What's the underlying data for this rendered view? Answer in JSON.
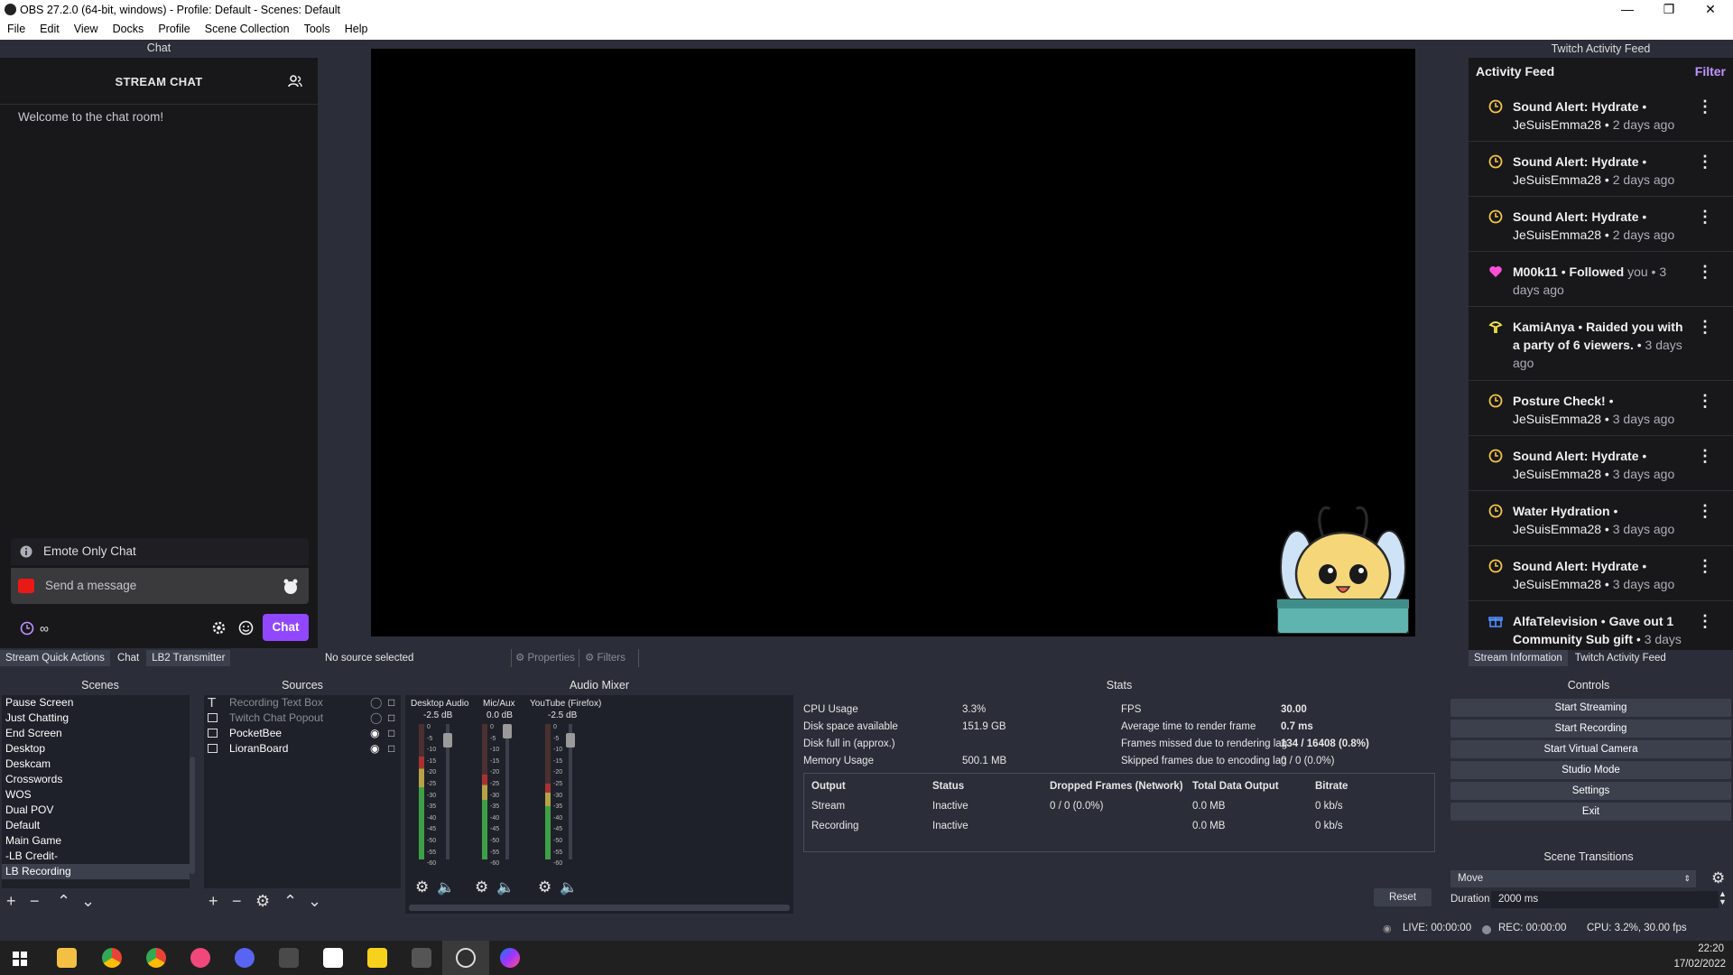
{
  "window": {
    "title": "OBS 27.2.0 (64-bit, windows) - Profile: Default - Scenes: Default"
  },
  "menu": [
    "File",
    "Edit",
    "View",
    "Docks",
    "Profile",
    "Scene Collection",
    "Tools",
    "Help"
  ],
  "chat_dock": {
    "dock_title": "Chat",
    "header": "STREAM CHAT",
    "welcome": "Welcome to the chat room!",
    "emote_only": "Emote Only Chat",
    "message_placeholder": "Send a message",
    "points": "∞",
    "send_button": "Chat"
  },
  "left_tabs": [
    "Stream Quick Actions",
    "Chat",
    "LB2 Transmitter"
  ],
  "source_toolbar": {
    "status": "No source selected",
    "properties": "Properties",
    "filters": "Filters"
  },
  "activity_feed": {
    "dock_title": "Twitch Activity Feed",
    "header": "Activity Feed",
    "filter": "Filter",
    "items": [
      {
        "title": "Sound Alert: Hydrate",
        "user": "JeSuisEmma28",
        "time": "2 days ago",
        "icon": "clock-icon"
      },
      {
        "title": "Sound Alert: Hydrate",
        "user": "JeSuisEmma28",
        "time": "2 days ago",
        "icon": "clock-icon"
      },
      {
        "title": "Sound Alert: Hydrate",
        "user": "JeSuisEmma28",
        "time": "2 days ago",
        "icon": "clock-icon"
      },
      {
        "title": "M00k11",
        "user": "Followed",
        "time": "you • 3 days ago",
        "icon": "heart-icon"
      },
      {
        "title": "KamiAnya",
        "user": "Raided you with a party of 6 viewers.",
        "time": "3 days ago",
        "icon": "raid-icon"
      },
      {
        "title": "Posture Check!",
        "user": "JeSuisEmma28",
        "time": "3 days ago",
        "icon": "clock-icon"
      },
      {
        "title": "Sound Alert: Hydrate",
        "user": "JeSuisEmma28",
        "time": "3 days ago",
        "icon": "clock-icon"
      },
      {
        "title": "Water Hydration",
        "user": "JeSuisEmma28",
        "time": "3 days ago",
        "icon": "clock-icon"
      },
      {
        "title": "Sound Alert: Hydrate",
        "user": "JeSuisEmma28",
        "time": "3 days ago",
        "icon": "clock-icon"
      },
      {
        "title": "AlfaTelevision",
        "user": "Gave out 1 Community Sub gift",
        "time": "3 days",
        "icon": "gift-icon"
      }
    ]
  },
  "right_tabs": [
    "Stream Information",
    "Twitch Activity Feed"
  ],
  "scenes": {
    "title": "Scenes",
    "items": [
      "Pause Screen",
      "Just Chatting",
      "End Screen",
      "Desktop",
      "Deskcam",
      "Crosswords",
      "WOS",
      "Dual POV",
      "Default",
      "Main Game",
      "-LB Credit-",
      "LB Recording"
    ],
    "selected": "LB Recording"
  },
  "sources": {
    "title": "Sources",
    "items": [
      {
        "name": "Recording Text Box",
        "visible": false
      },
      {
        "name": "Twitch Chat Popout",
        "visible": false
      },
      {
        "name": "PocketBee",
        "visible": true
      },
      {
        "name": "LioranBoard",
        "visible": true
      }
    ]
  },
  "audio_mixer": {
    "title": "Audio Mixer",
    "channels": [
      {
        "name": "Desktop Audio",
        "db": "-2.5 dB"
      },
      {
        "name": "Mic/Aux",
        "db": "0.0 dB"
      },
      {
        "name": "YouTube (Firefox)",
        "db": "-2.5 dB"
      }
    ],
    "scale": [
      "0",
      "-5",
      "-10",
      "-15",
      "-20",
      "-25",
      "-30",
      "-35",
      "-40",
      "-45",
      "-50",
      "-55",
      "-60"
    ]
  },
  "stats": {
    "title": "Stats",
    "left": [
      {
        "label": "CPU Usage",
        "value": "3.3%"
      },
      {
        "label": "Disk space available",
        "value": "151.9 GB"
      },
      {
        "label": "Disk full in (approx.)",
        "value": ""
      },
      {
        "label": "Memory Usage",
        "value": "500.1 MB"
      }
    ],
    "right": [
      {
        "label": "FPS",
        "value": "30.00"
      },
      {
        "label": "Average time to render frame",
        "value": "0.7 ms"
      },
      {
        "label": "Frames missed due to rendering lag",
        "value": "134 / 16408 (0.8%)"
      },
      {
        "label": "Skipped frames due to encoding lag",
        "value": "0 / 0 (0.0%)"
      }
    ],
    "table_headers": [
      "Output",
      "Status",
      "Dropped Frames (Network)",
      "Total Data Output",
      "Bitrate"
    ],
    "rows": [
      [
        "Stream",
        "Inactive",
        "0 / 0 (0.0%)",
        "0.0 MB",
        "0 kb/s"
      ],
      [
        "Recording",
        "Inactive",
        "",
        "0.0 MB",
        "0 kb/s"
      ]
    ],
    "reset": "Reset"
  },
  "controls": {
    "title": "Controls",
    "buttons": [
      "Start Streaming",
      "Start Recording",
      "Start Virtual Camera",
      "Studio Mode",
      "Settings",
      "Exit"
    ]
  },
  "transitions": {
    "title": "Scene Transitions",
    "selected": "Move",
    "duration_label": "Duration",
    "duration_value": "2000 ms"
  },
  "status_bar": {
    "live": "LIVE: 00:00:00",
    "rec": "REC: 00:00:00",
    "cpu": "CPU: 3.2%, 30.00 fps"
  },
  "taskbar": {
    "time": "22:20",
    "date": "17/02/2022"
  }
}
